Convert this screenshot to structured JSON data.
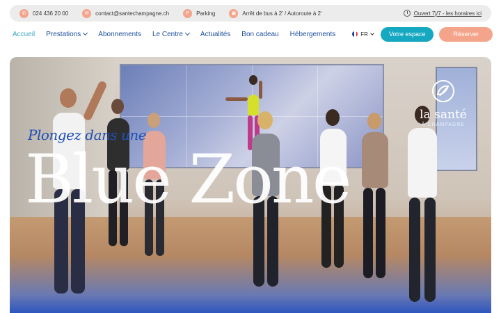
{
  "infobar": {
    "phone": "024 436 20 00",
    "email": "contact@santechampagne.ch",
    "parking": "Parking",
    "transport": "Arrêt de bus à 2' / Autoroute à 2'",
    "hours": "Ouvert 7j/7 - les horaires ici",
    "icons": [
      "phone-icon",
      "mail-icon",
      "parking-icon",
      "bus-icon"
    ]
  },
  "nav": {
    "items": [
      {
        "label": "Accueil",
        "active": true
      },
      {
        "label": "Prestations",
        "dropdown": true
      },
      {
        "label": "Abonnements"
      },
      {
        "label": "Le Centre",
        "dropdown": true
      },
      {
        "label": "Actualités"
      },
      {
        "label": "Bon cadeau"
      },
      {
        "label": "Hébergements"
      }
    ],
    "language": "FR",
    "space_button": "Votre espace",
    "book_button": "Réserver"
  },
  "hero": {
    "tagline": "Plongez dans une",
    "headline": "Blue Zone",
    "logo_name": "la santé",
    "logo_sub": "À CHAMPAGNE"
  },
  "colors": {
    "accent": "#15a8c0",
    "brand_blue": "#1e4f9c",
    "peach": "#f4a48a"
  }
}
